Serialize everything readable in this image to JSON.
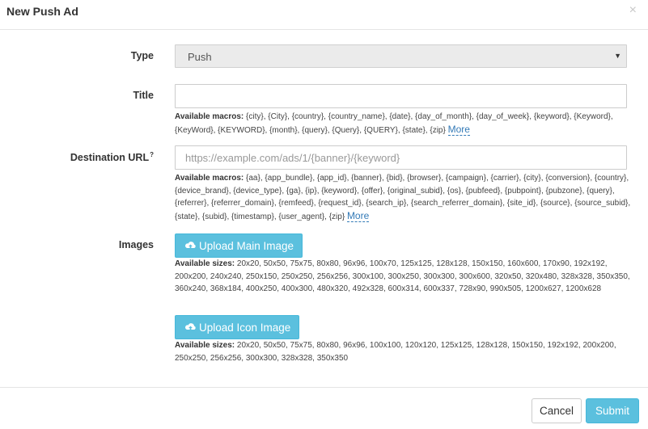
{
  "header": {
    "title": "New Push Ad",
    "close_glyph": "×",
    "close_icon": "close-icon"
  },
  "form": {
    "type": {
      "label": "Type",
      "value": "Push",
      "caret_glyph": "▼"
    },
    "title": {
      "label": "Title",
      "value": "",
      "placeholder": "",
      "macros_label": "Available macros:",
      "macros": "{city}, {City}, {country}, {country_name}, {date}, {day_of_month}, {day_of_week}, {keyword}, {Keyword}, {KeyWord}, {KEYWORD}, {month}, {query}, {Query}, {QUERY}, {state}, {zip}",
      "more_label": "More"
    },
    "destination_url": {
      "label": "Destination URL",
      "help_marker": "?",
      "value": "",
      "placeholder": "https://example.com/ads/1/{banner}/{keyword}",
      "macros_label": "Available macros:",
      "macros": "{aa}, {app_bundle}, {app_id}, {banner}, {bid}, {browser}, {campaign}, {carrier}, {city}, {conversion}, {country}, {device_brand}, {device_type}, {ga}, {ip}, {keyword}, {offer}, {original_subid}, {os}, {pubfeed}, {pubpoint}, {pubzone}, {query}, {referrer}, {referrer_domain}, {remfeed}, {request_id}, {search_ip}, {search_referrer_domain}, {site_id}, {source}, {source_subid}, {state}, {subid}, {timestamp}, {user_agent}, {zip}",
      "more_label": "More"
    },
    "images": {
      "label": "Images",
      "main": {
        "button_label": "Upload Main Image",
        "icon": "cloud-upload-icon",
        "sizes_label": "Available sizes:",
        "sizes": "20x20, 50x50, 75x75, 80x80, 96x96, 100x70, 125x125, 128x128, 150x150, 160x600, 170x90, 192x192, 200x200, 240x240, 250x150, 250x250, 256x256, 300x100, 300x250, 300x300, 300x600, 320x50, 320x480, 328x328, 350x350, 360x240, 368x184, 400x250, 400x300, 480x320, 492x328, 600x314, 600x337, 728x90, 990x505, 1200x627, 1200x628"
      },
      "icon_image": {
        "button_label": "Upload Icon Image",
        "icon": "cloud-upload-icon",
        "sizes_label": "Available sizes:",
        "sizes": "20x20, 50x50, 75x75, 80x80, 96x96, 100x100, 120x120, 125x125, 128x128, 150x150, 192x192, 200x200, 250x250, 256x256, 300x300, 328x328, 350x350"
      }
    }
  },
  "footer": {
    "cancel_label": "Cancel",
    "submit_label": "Submit"
  },
  "colors": {
    "accent": "#5bc0de",
    "link": "#337ab7"
  }
}
